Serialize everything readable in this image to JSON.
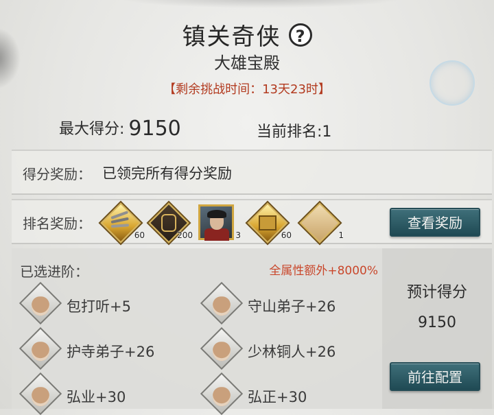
{
  "header": {
    "title": "镇关奇侠",
    "help_glyph": "?",
    "subtitle": "大雄宝殿",
    "timer": "【剩余挑战时间：13天23时】"
  },
  "stats": {
    "max_score_label": "最大得分:",
    "max_score_value": "9150",
    "rank_label": "当前排名:1"
  },
  "score_reward": {
    "label": "得分奖励：",
    "text": "已领完所有得分奖励"
  },
  "rank_reward": {
    "label": "排名奖励：",
    "items": [
      {
        "icon": "feather-darts-icon",
        "count": "60"
      },
      {
        "icon": "crest-token-icon",
        "count": "200"
      },
      {
        "icon": "hero-portrait-icon",
        "count": "3"
      },
      {
        "icon": "golden-book-icon",
        "count": "60"
      },
      {
        "icon": "title-plaque-icon",
        "count": "1"
      }
    ],
    "button_label": "查看奖励"
  },
  "selection": {
    "label": "已选进阶：",
    "bonus_text": "全属性额外+8000%",
    "npcs": [
      {
        "name": "包打听+5"
      },
      {
        "name": "守山弟子+26"
      },
      {
        "name": "护寺弟子+26"
      },
      {
        "name": "少林铜人+26"
      },
      {
        "name": "弘业+30"
      },
      {
        "name": "弘正+30"
      }
    ]
  },
  "estimate": {
    "label": "预计得分",
    "value": "9150",
    "button_label": "前往配置"
  },
  "colors": {
    "accent_red": "#b23a1f",
    "bonus_orange": "#c9472b",
    "button_teal": "#2f5f6a",
    "gold_frame": "#d4b25a"
  }
}
